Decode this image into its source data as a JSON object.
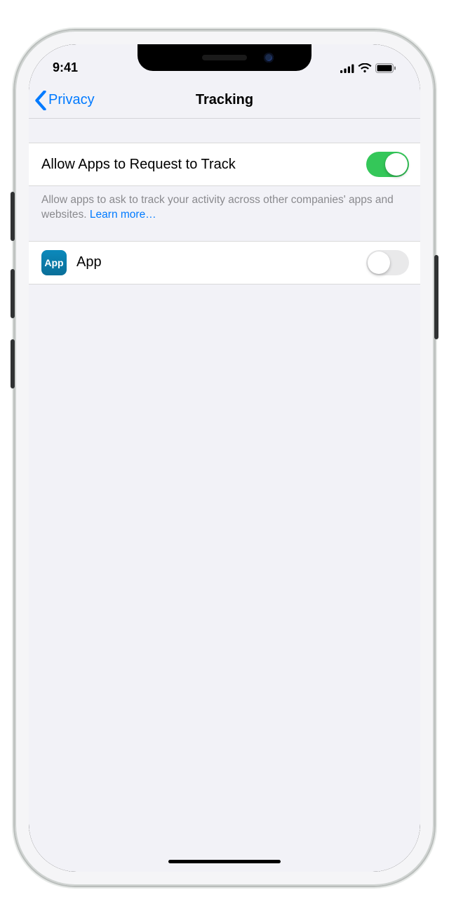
{
  "status": {
    "time": "9:41"
  },
  "nav": {
    "back_label": "Privacy",
    "title": "Tracking"
  },
  "main_toggle": {
    "label": "Allow Apps to Request to Track",
    "on": true,
    "footer": "Allow apps to ask to track your activity across other companies' apps and websites. ",
    "learn_more": "Learn more…"
  },
  "apps": [
    {
      "icon_text": "App",
      "name": "App",
      "on": false
    }
  ]
}
